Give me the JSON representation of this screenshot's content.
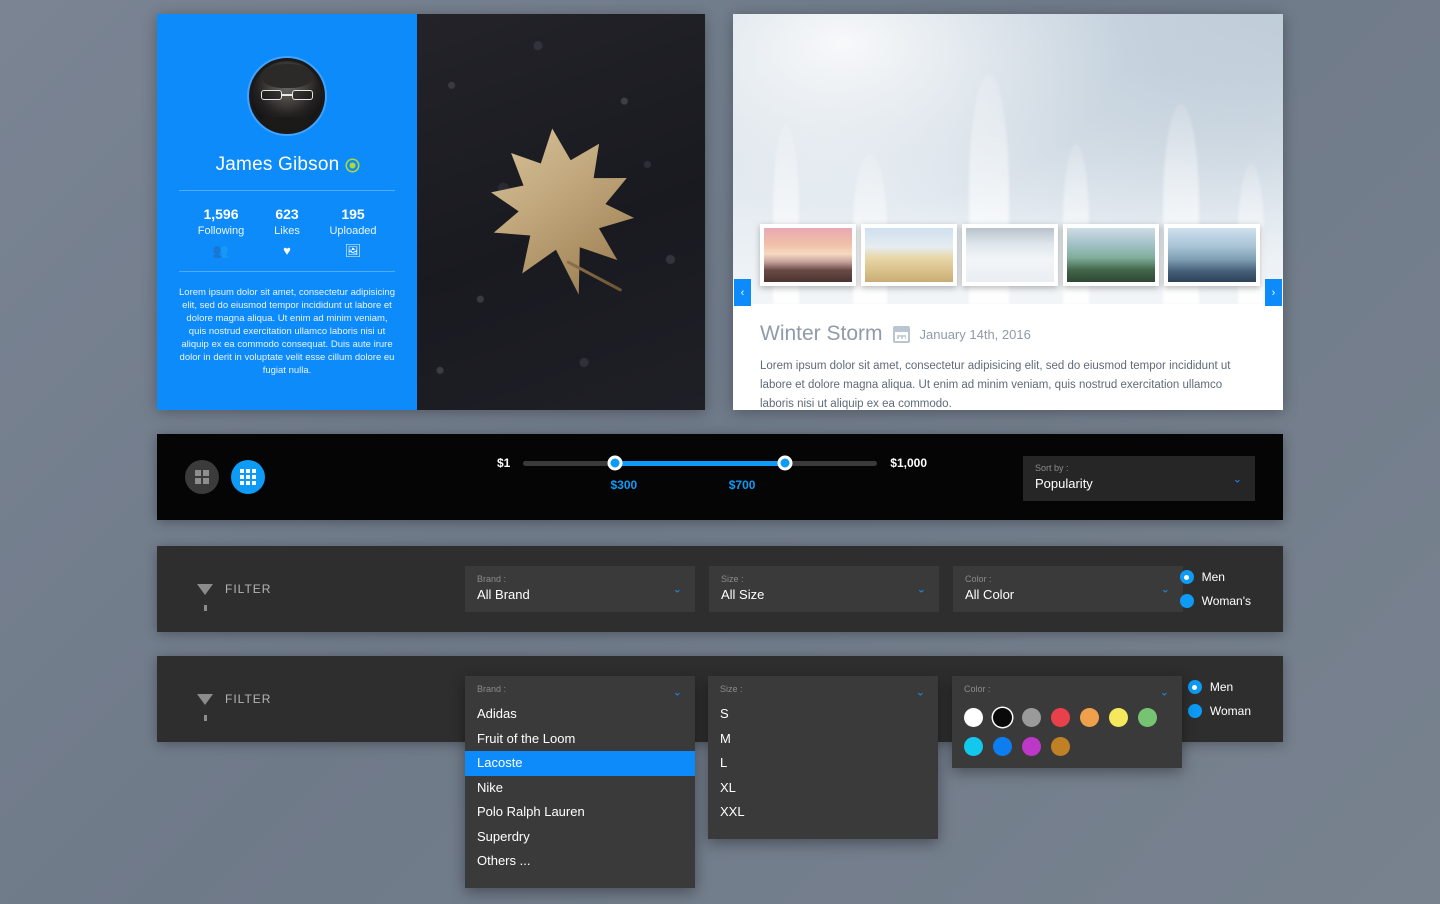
{
  "profile": {
    "name": "James Gibson",
    "verified_icon": "verified-dot-icon",
    "stats": [
      {
        "value": "1,596",
        "label": "Following",
        "icon": "users-icon",
        "glyph": "👥"
      },
      {
        "value": "623",
        "label": "Likes",
        "icon": "heart-icon",
        "glyph": "♥"
      },
      {
        "value": "195",
        "label": "Uploaded",
        "icon": "image-icon",
        "glyph": "🖼"
      }
    ],
    "bio": "Lorem ipsum dolor sit amet, consectetur adipisicing elit, sed do eiusmod tempor incididunt ut labore et dolore magna aliqua. Ut enim ad minim veniam, quis nostrud exercitation ullamco laboris nisi ut aliquip ex ea commodo consequat. Duis aute irure dolor in derit in voluptate velit esse cillum dolore eu fugiat nulla."
  },
  "story": {
    "title": "Winter Storm",
    "date": "January 14th, 2016",
    "calendar_icon": "calendar-icon",
    "text": "Lorem ipsum dolor sit amet, consectetur adipisicing elit, sed do eiusmod tempor incididunt ut labore et dolore magna aliqua. Ut enim ad minim veniam, quis nostrud exercitation ullamco laboris nisi ut aliquip ex ea commodo.",
    "prev_arrow": "‹",
    "next_arrow": "›",
    "thumbnails": [
      "sunset-beach",
      "white-village",
      "frost-field",
      "green-lake",
      "blue-mountains"
    ]
  },
  "toolbar": {
    "view_grid_small_icon": "grid-2x2-icon",
    "view_grid_large_icon": "grid-3x3-icon",
    "price": {
      "min_label": "$1",
      "max_label": "$1,000",
      "low_value": "$300",
      "high_value": "$700",
      "low_pct": 26,
      "high_pct": 74
    },
    "sort": {
      "label": "Sort by :",
      "value": "Popularity",
      "chevron": "⌄"
    }
  },
  "filter_collapsed": {
    "title": "FILTER",
    "filter_icon": "funnel-icon",
    "selects": [
      {
        "label": "Brand :",
        "value": "All Brand",
        "chevron": "⌄"
      },
      {
        "label": "Size :",
        "value": "All Size",
        "chevron": "⌄"
      },
      {
        "label": "Color :",
        "value": "All Color",
        "chevron": "⌄"
      }
    ],
    "genders": [
      {
        "label": "Men",
        "selected": true
      },
      {
        "label": "Woman's",
        "selected": false
      }
    ]
  },
  "filter_expanded": {
    "title": "FILTER",
    "filter_icon": "funnel-icon",
    "brand": {
      "label": "Brand :",
      "chevron": "⌄",
      "options": [
        "Adidas",
        "Fruit of the Loom",
        "Lacoste",
        "Nike",
        "Polo Ralph Lauren",
        "Superdry",
        "Others ..."
      ],
      "selected": "Lacoste"
    },
    "size": {
      "label": "Size :",
      "chevron": "⌄",
      "options": [
        "S",
        "M",
        "L",
        "XL",
        "XXL"
      ],
      "selected": null
    },
    "color": {
      "label": "Color :",
      "chevron": "⌄",
      "swatches": [
        {
          "name": "white",
          "hex": "#ffffff",
          "ring": false
        },
        {
          "name": "black",
          "hex": "#0a0a0a",
          "ring": true
        },
        {
          "name": "gray",
          "hex": "#9a9a9a",
          "ring": false
        },
        {
          "name": "red",
          "hex": "#e8414c",
          "ring": false
        },
        {
          "name": "orange",
          "hex": "#f0a04a",
          "ring": false
        },
        {
          "name": "yellow",
          "hex": "#f5e85c",
          "ring": false
        },
        {
          "name": "green",
          "hex": "#76c473",
          "ring": false
        },
        {
          "name": "cyan",
          "hex": "#12c8ec",
          "ring": false
        },
        {
          "name": "blue",
          "hex": "#0d7ef0",
          "ring": false
        },
        {
          "name": "magenta",
          "hex": "#bd38c8",
          "ring": false
        },
        {
          "name": "brown",
          "hex": "#bf8026",
          "ring": false
        }
      ]
    },
    "genders": [
      {
        "label": "Men",
        "selected": true
      },
      {
        "label": "Woman",
        "selected": false
      }
    ]
  },
  "theme": {
    "accent": "#0d8bfb",
    "accent_bright": "#0d9bf5",
    "background": "#737e8c",
    "panel_dark": "#2e2e2e",
    "toolbar_black": "#050505"
  }
}
